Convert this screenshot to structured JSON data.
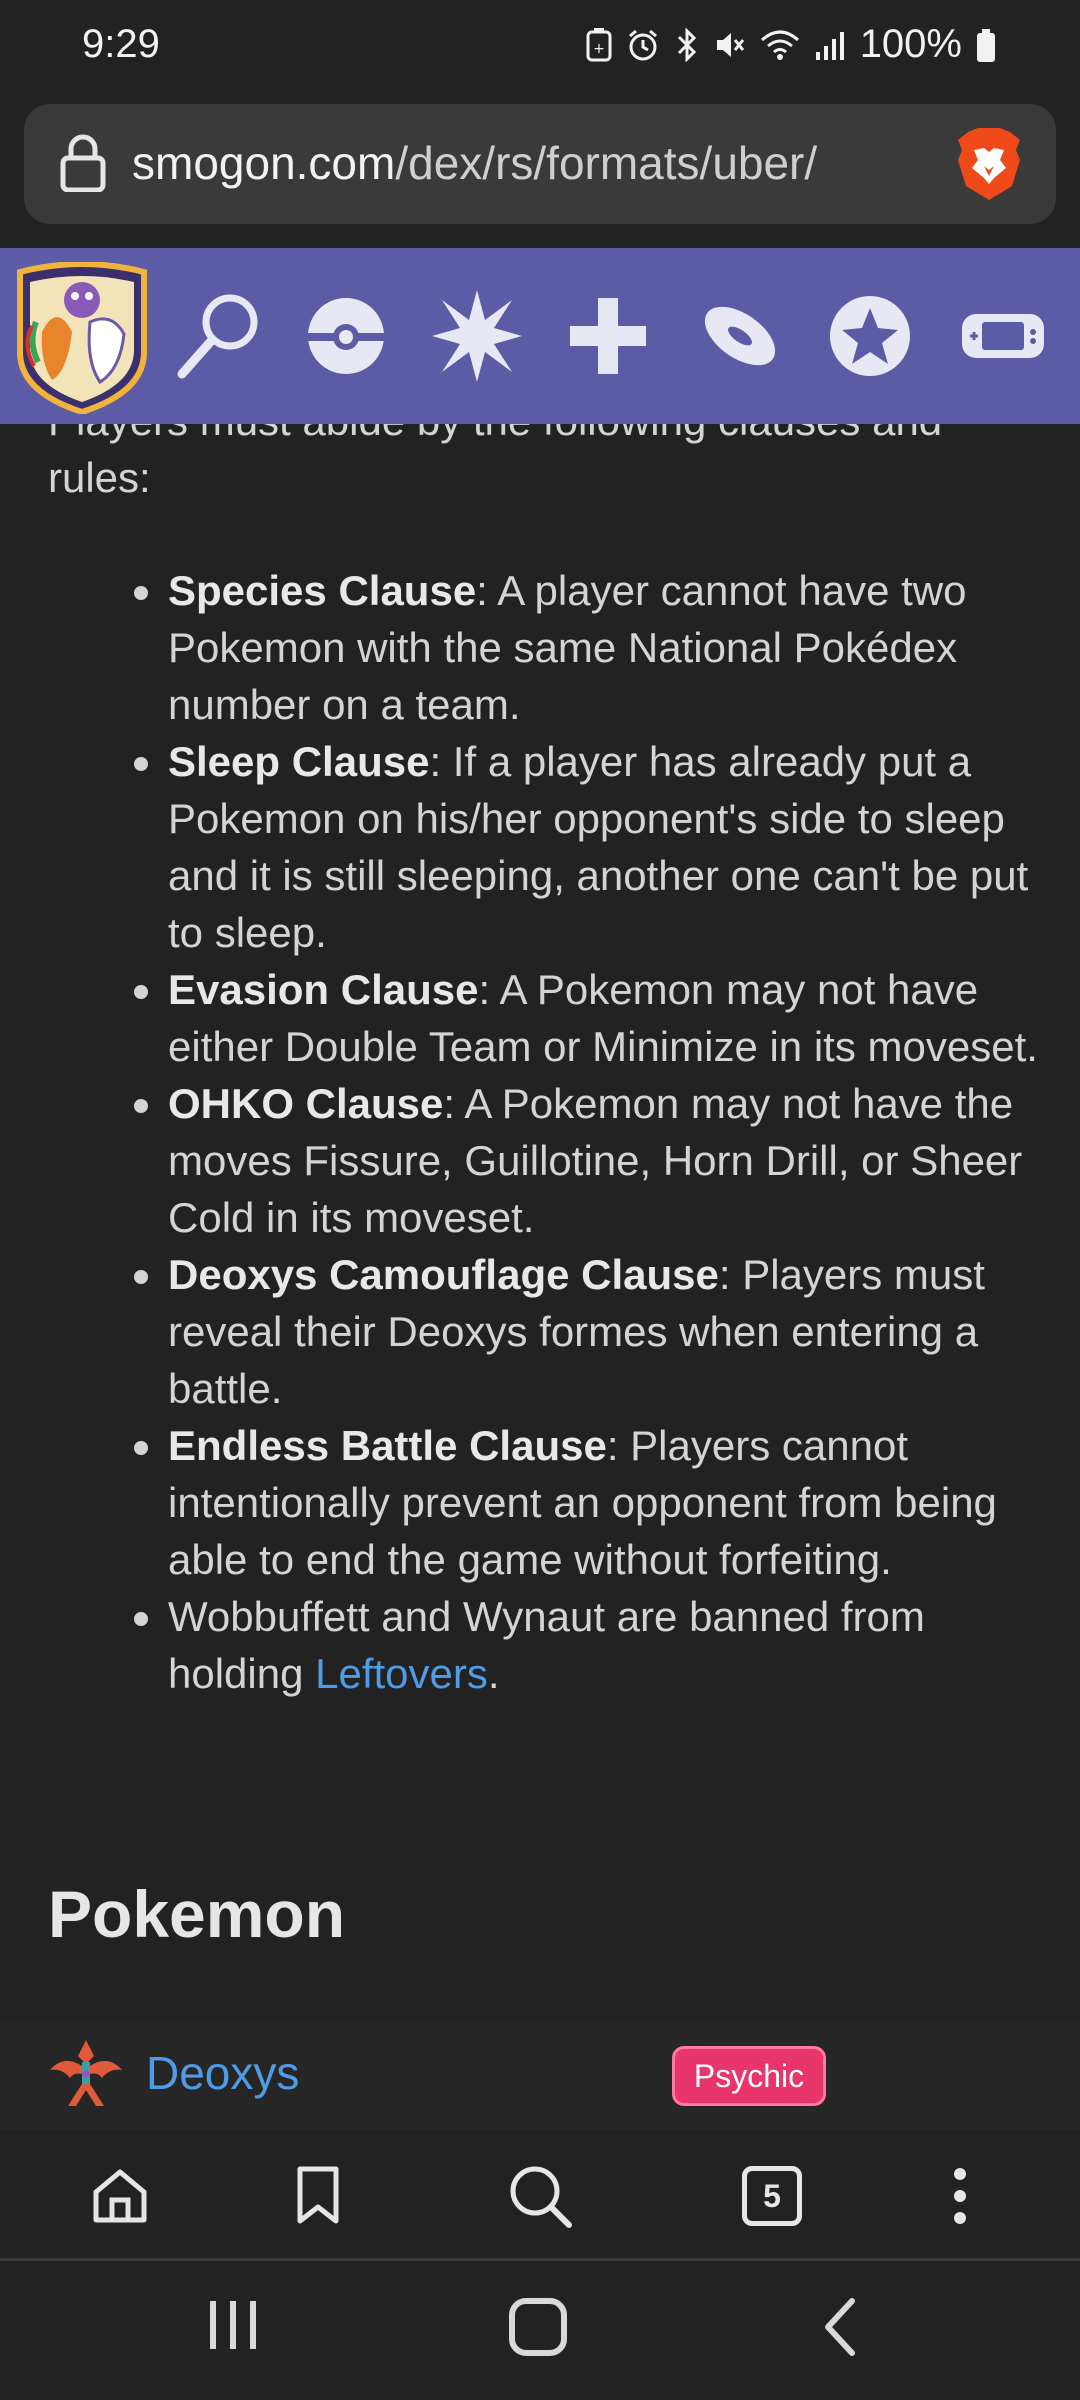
{
  "status_bar": {
    "time": "9:29",
    "battery": "100%"
  },
  "address_bar": {
    "domain": "smogon.com",
    "path": "/dex/rs/formats/uber/"
  },
  "site_nav": {
    "items": [
      "search-icon",
      "pokeball-icon",
      "move-icon",
      "item-icon",
      "ability-icon",
      "nature-icon",
      "format-icon"
    ]
  },
  "content": {
    "intro": "Players must abide by the following clauses and rules:",
    "rules": [
      {
        "name": "Species Clause",
        "text": ": A player cannot have two Pokemon with the same National Pokédex number on a team."
      },
      {
        "name": "Sleep Clause",
        "text": ": If a player has already put a Pokemon on his/her opponent's side to sleep and it is still sleeping, another one can't be put to sleep."
      },
      {
        "name": "Evasion Clause",
        "text": ": A Pokemon may not have either Double Team or Minimize in its moveset."
      },
      {
        "name": "OHKO Clause",
        "text": ": A Pokemon may not have the moves Fissure, Guillotine, Horn Drill, or Sheer Cold in its moveset."
      },
      {
        "name": "Deoxys Camouflage Clause",
        "text": ": Players must reveal their Deoxys formes when entering a battle."
      },
      {
        "name": "Endless Battle Clause",
        "text": ": Players cannot intentionally prevent an opponent from being able to end the game without forfeiting."
      }
    ],
    "last_rule": {
      "text": "Wobbuffett and Wynaut are banned from holding ",
      "link": "Leftovers",
      "end": "."
    },
    "section_heading": "Pokemon"
  },
  "pokemon_row": {
    "name": "Deoxys",
    "type": "Psychic",
    "type_color": "#e8356b"
  },
  "toolbar": {
    "tab_count": "5"
  },
  "colors": {
    "nav_bar": "#5b5ba6",
    "link": "#4f9be6",
    "background": "#222222"
  }
}
